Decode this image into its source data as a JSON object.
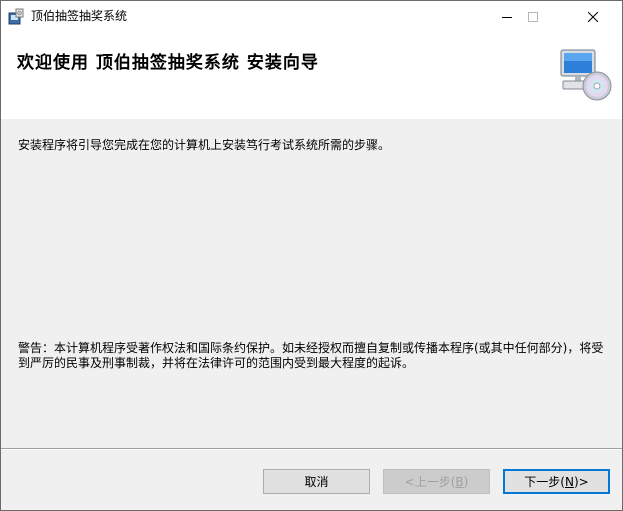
{
  "window": {
    "title": "顶伯抽签抽奖系统"
  },
  "header": {
    "title": "欢迎使用 顶伯抽签抽奖系统 安装向导"
  },
  "body": {
    "intro": "安装程序将引导您完成在您的计算机上安装笃行考试系统所需的步骤。",
    "warning": "警告：本计算机程序受著作权法和国际条约保护。如未经授权而擅自复制或传播本程序(或其中任何部分)，将受到严厉的民事及刑事制裁，并将在法律许可的范围内受到最大程度的起诉。"
  },
  "buttons": {
    "cancel": "取消",
    "back_arrow": "<",
    "back_label": " 上一步(",
    "back_key": "B",
    "back_close": ")",
    "next_label": "下一步(",
    "next_key": "N",
    "next_close": ")",
    "next_arrow": " >"
  },
  "icons": {
    "app": "installer-icon",
    "minimize": "minimize-icon",
    "maximize": "maximize-icon",
    "close": "close-icon",
    "setup": "computer-cd-icon"
  }
}
